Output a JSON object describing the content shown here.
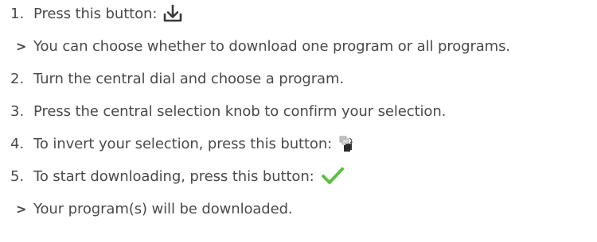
{
  "steps": [
    {
      "marker": "1.",
      "text": "Press this button:",
      "icon": "download-icon"
    },
    {
      "marker": ">",
      "text": "You can choose whether to download one program or all programs."
    },
    {
      "marker": "2.",
      "text": "Turn the central dial and choose a program."
    },
    {
      "marker": "3.",
      "text": "Press the central selection knob to confirm your selection."
    },
    {
      "marker": "4.",
      "text": "To invert your selection, press this button:",
      "icon": "invert-selection-icon"
    },
    {
      "marker": "5.",
      "text": "To start downloading, press this button:",
      "icon": "checkmark-icon"
    },
    {
      "marker": ">",
      "text": "Your program(s) will be downloaded."
    }
  ],
  "colors": {
    "text": "#4a4a4a",
    "checkmark": "#5cc142",
    "invert_light": "#c8c8c8",
    "invert_dark": "#3a3a3a"
  }
}
